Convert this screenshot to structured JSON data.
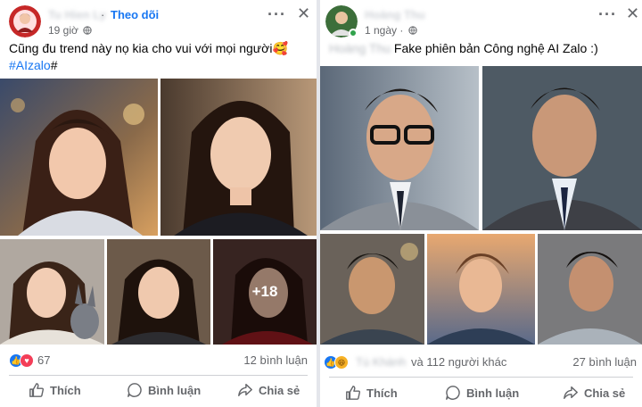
{
  "left_post": {
    "author": "Tu Hien Ly",
    "time": "19 giờ",
    "follow_label": "Theo dõi",
    "caption": "Cũng đu trend này nọ kia cho vui với mọi người🥰",
    "hashtag": "#AIzalo",
    "hashtag_tail": "#",
    "more_photos_label": "+18",
    "reaction_count": "67",
    "comments": "12 bình luận",
    "actions": {
      "like": "Thích",
      "comment": "Bình luận",
      "share": "Chia sẻ"
    }
  },
  "right_post": {
    "author": "Hoàng Thu",
    "time": "1 ngày",
    "caption_prefix": "Hoàng Thu",
    "caption": "Fake phiên bản Công nghệ AI Zalo :)",
    "reactor_name": "Tú Khánh",
    "reaction_text": "và 112 người khác",
    "comments": "27 bình luận",
    "actions": {
      "like": "Thích",
      "comment": "Bình luận",
      "share": "Chia sẻ"
    }
  },
  "colors": {
    "accent": "#1877f2",
    "secondary_text": "#65676b",
    "like": "#1877f2",
    "love": "#f33e58",
    "haha": "#f7b125",
    "online": "#31a24c"
  },
  "icons": {
    "like": "thumb-up-icon",
    "comment": "speech-bubble-icon",
    "share": "share-arrow-icon",
    "globe": "globe-icon",
    "more": "more-dots-icon",
    "close": "close-icon"
  }
}
